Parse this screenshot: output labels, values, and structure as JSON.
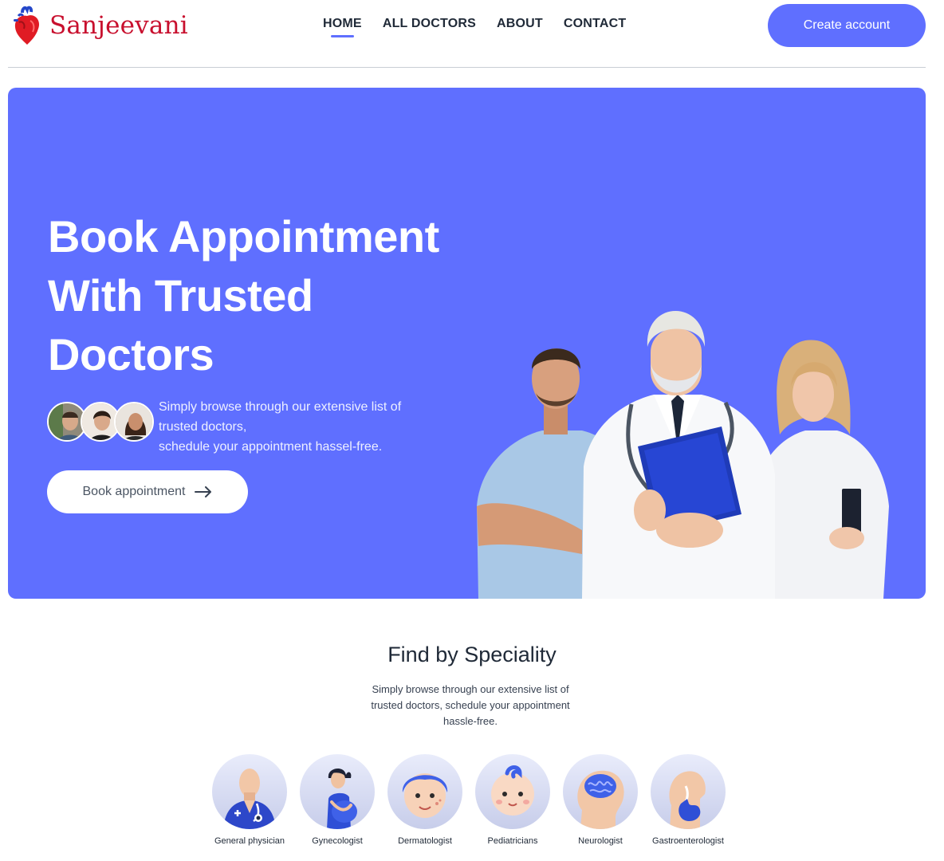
{
  "brand": {
    "name": "Sanjeevani",
    "color": "#c8102e",
    "logo_icon": "heart-anatomy-icon"
  },
  "nav": {
    "links": [
      {
        "label": "HOME",
        "active": true
      },
      {
        "label": "ALL DOCTORS",
        "active": false
      },
      {
        "label": "ABOUT",
        "active": false
      },
      {
        "label": "CONTACT",
        "active": false
      }
    ],
    "cta_label": "Create account"
  },
  "hero": {
    "title_lines": [
      "Book Appointment",
      "With Trusted",
      "Doctors"
    ],
    "description_lines": [
      "Simply browse through our extensive list of",
      "trusted doctors,",
      "schedule your appointment hassel-free."
    ],
    "button_label": "Book appointment",
    "button_icon": "arrow-right-icon",
    "background": "#5f6fff"
  },
  "speciality": {
    "title": "Find by Speciality",
    "description_lines": [
      "Simply browse through our extensive list of",
      "trusted doctors, schedule your appointment",
      "hassle-free."
    ],
    "items": [
      {
        "label": "General physician",
        "icon": "general-physician-icon"
      },
      {
        "label": "Gynecologist",
        "icon": "gynecologist-icon"
      },
      {
        "label": "Dermatologist",
        "icon": "dermatologist-icon"
      },
      {
        "label": "Pediatricians",
        "icon": "pediatrician-icon"
      },
      {
        "label": "Neurologist",
        "icon": "neurologist-icon"
      },
      {
        "label": "Gastroenterologist",
        "icon": "gastroenterologist-icon"
      }
    ]
  },
  "colors": {
    "primary": "#5f6fff",
    "text": "#1f2937"
  }
}
